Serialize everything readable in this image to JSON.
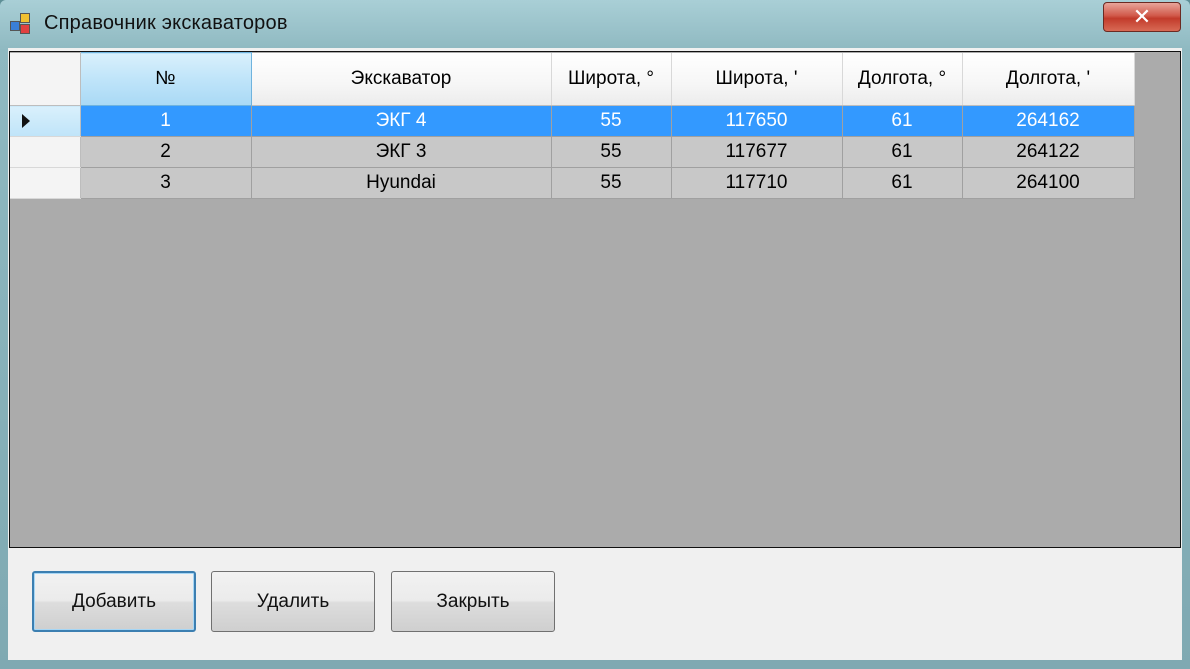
{
  "window": {
    "title": "Справочник экскаваторов",
    "close_glyph": "✕"
  },
  "grid": {
    "columns": [
      "№",
      "Экскаватор",
      "Широта, °",
      "Широта, '",
      "Долгота, °",
      "Долгота, '"
    ],
    "rows": [
      [
        "1",
        "ЭКГ 4",
        "55",
        "117650",
        "61",
        "264162"
      ],
      [
        "2",
        "ЭКГ 3",
        "55",
        "117677",
        "61",
        "264122"
      ],
      [
        "3",
        "Hyundai",
        "55",
        "117710",
        "61",
        "264100"
      ]
    ],
    "selected_row": 0
  },
  "buttons": {
    "add": "Добавить",
    "delete": "Удалить",
    "close": "Закрыть"
  },
  "colors": {
    "selection": "#3399ff",
    "grid_background": "#ababab"
  }
}
